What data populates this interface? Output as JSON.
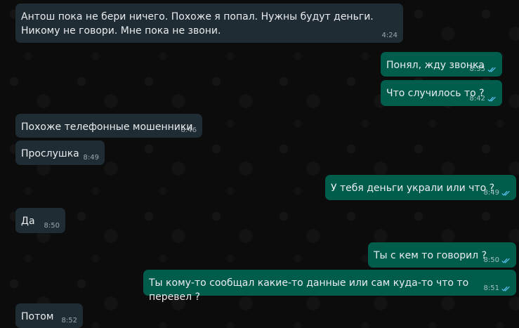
{
  "messages": [
    {
      "direction": "incoming",
      "text": "Антош пока не бери ничего. Похоже я попал. Нужны будут деньги. Никому не говори. Мне пока не звони.",
      "time": "4:24"
    },
    {
      "direction": "outgoing",
      "text": "Понял, жду звонка",
      "time": "8:35",
      "status": "read"
    },
    {
      "direction": "outgoing",
      "text": "Что случилось то ?",
      "time": "8:42",
      "status": "read"
    },
    {
      "direction": "incoming",
      "text": "Похоже телефонные мошенники",
      "time": "8:46"
    },
    {
      "direction": "incoming",
      "text": "Прослушка",
      "time": "8:49"
    },
    {
      "direction": "outgoing",
      "text": "У тебя деньги украли или что ?",
      "time": "8:49",
      "status": "read"
    },
    {
      "direction": "incoming",
      "text": "Да",
      "time": "8:50"
    },
    {
      "direction": "outgoing",
      "text": "Ты с кем то говорил ?",
      "time": "8:50",
      "status": "read"
    },
    {
      "direction": "outgoing",
      "text": "Ты кому-то сообщал какие-то данные или сам куда-то что то перевел ?",
      "time": "8:51",
      "status": "read"
    },
    {
      "direction": "incoming",
      "text": "Потом",
      "time": "8:52"
    }
  ],
  "colors": {
    "background": "#0c0c0c",
    "incoming_bubble": "#202c33",
    "outgoing_bubble": "#005c4b",
    "text": "#e9edef",
    "read_tick": "#53bdeb"
  },
  "icons": {
    "read_status": "double-check-icon"
  }
}
